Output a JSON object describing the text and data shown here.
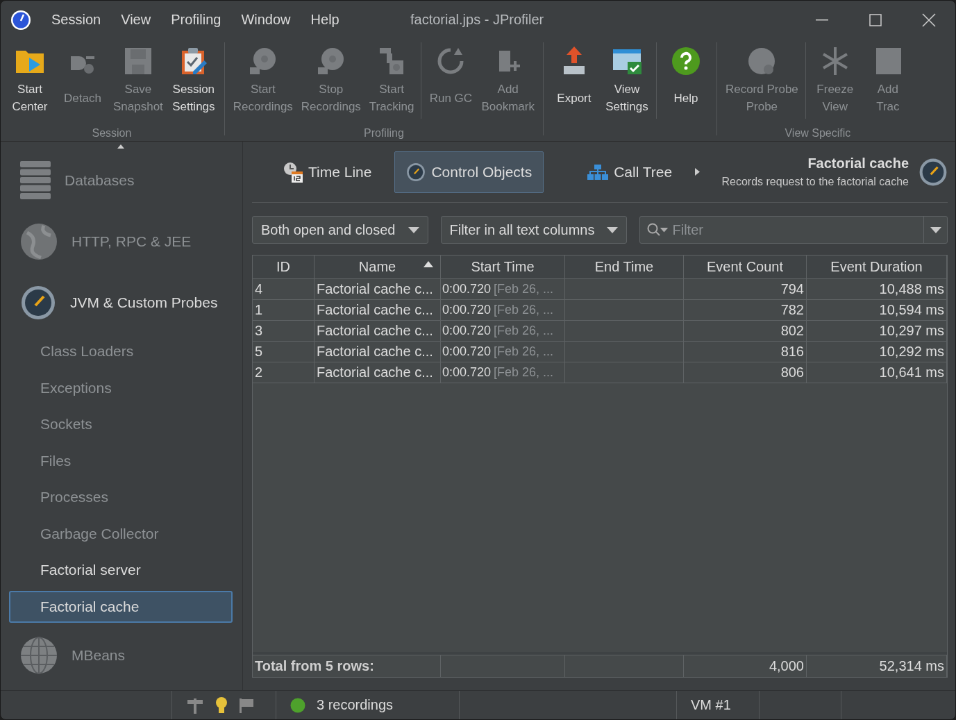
{
  "window": {
    "title": "factorial.jps - JProfiler"
  },
  "menu": [
    {
      "label": "Session"
    },
    {
      "label": "View"
    },
    {
      "label": "Profiling"
    },
    {
      "label": "Window"
    },
    {
      "label": "Help"
    }
  ],
  "toolbar": {
    "groups": [
      {
        "label": "Session",
        "sections": [
          [
            {
              "kind": "start",
              "lines": [
                "Start",
                "Center"
              ],
              "disabled": false
            },
            {
              "kind": "detach",
              "lines": [
                "Detach"
              ],
              "disabled": true
            },
            {
              "kind": "save",
              "lines": [
                "Save",
                "Snapshot"
              ],
              "disabled": true
            },
            {
              "kind": "settings",
              "lines": [
                "Session",
                "Settings"
              ],
              "disabled": false
            }
          ]
        ]
      },
      {
        "label": "Profiling",
        "sections": [
          [
            {
              "kind": "reel",
              "lines": [
                "Start",
                "Recordings"
              ],
              "disabled": true
            },
            {
              "kind": "reel",
              "lines": [
                "Stop",
                "Recordings"
              ],
              "disabled": true
            },
            {
              "kind": "tracking",
              "lines": [
                "Start",
                "Tracking"
              ],
              "disabled": true
            }
          ],
          [
            {
              "kind": "gc",
              "lines": [
                "Run GC"
              ],
              "disabled": true
            },
            {
              "kind": "bookmark",
              "lines": [
                "Add",
                "Bookmark"
              ],
              "disabled": true
            }
          ]
        ]
      },
      {
        "sections": [
          [
            {
              "kind": "export",
              "lines": [
                "Export"
              ],
              "disabled": false
            },
            {
              "kind": "view",
              "lines": [
                "View",
                "Settings"
              ],
              "disabled": false
            }
          ],
          [
            {
              "kind": "help",
              "lines": [
                "Help"
              ],
              "disabled": false
            }
          ]
        ]
      },
      {
        "label": "View Specific",
        "sections": [
          [
            {
              "kind": "probe",
              "lines": [
                "Record Probe",
                "Probe"
              ],
              "disabled": true
            }
          ],
          [
            {
              "kind": "freeze",
              "lines": [
                "Freeze",
                "View"
              ],
              "disabled": true
            },
            {
              "kind": "trace",
              "lines": [
                "Add",
                "Trac"
              ],
              "disabled": true
            }
          ]
        ]
      }
    ]
  },
  "sidebar": {
    "items": [
      {
        "kind": "database",
        "label": "Databases",
        "active": false
      },
      {
        "kind": "globe",
        "label": "HTTP, RPC & JEE",
        "active": false
      },
      {
        "kind": "gauge",
        "label": "JVM & Custom Probes",
        "active": true,
        "children": [
          {
            "label": "Class Loaders",
            "active": false,
            "selected": false
          },
          {
            "label": "Exceptions",
            "active": false,
            "selected": false
          },
          {
            "label": "Sockets",
            "active": false,
            "selected": false
          },
          {
            "label": "Files",
            "active": false,
            "selected": false
          },
          {
            "label": "Processes",
            "active": false,
            "selected": false
          },
          {
            "label": "Garbage Collector",
            "active": false,
            "selected": false
          },
          {
            "label": "Factorial server",
            "active": true,
            "selected": false
          },
          {
            "label": "Factorial cache",
            "active": true,
            "selected": true
          }
        ]
      },
      {
        "kind": "mbean",
        "label": "MBeans",
        "active": false
      }
    ]
  },
  "view_tabs": [
    {
      "kind": "timeline",
      "label": "Time Line",
      "selected": false
    },
    {
      "kind": "control",
      "label": "Control Objects",
      "selected": true
    },
    {
      "kind": "calltree",
      "label": "Call Tree",
      "selected": false
    }
  ],
  "probe_header": {
    "title": "Factorial cache",
    "description": "Records request to the factorial cache"
  },
  "filters": {
    "state_dropdown": "Both open and closed",
    "column_dropdown": "Filter in all text columns",
    "search": {
      "placeholder": "Filter"
    }
  },
  "table": {
    "columns": [
      {
        "label": "ID",
        "sorted": false
      },
      {
        "label": "Name",
        "sorted": true
      },
      {
        "label": "Start Time",
        "sorted": false
      },
      {
        "label": "End Time",
        "sorted": false
      },
      {
        "label": "Event Count",
        "sorted": false
      },
      {
        "label": "Event Duration",
        "sorted": false
      }
    ],
    "rows": [
      {
        "id": "4",
        "name": "Factorial cache c...",
        "start": "0:00.720",
        "start_date": "[Feb 26, ...",
        "count": "794",
        "duration": "10,488 ms"
      },
      {
        "id": "1",
        "name": "Factorial cache c...",
        "start": "0:00.720",
        "start_date": "[Feb 26, ...",
        "count": "782",
        "duration": "10,594 ms"
      },
      {
        "id": "3",
        "name": "Factorial cache c...",
        "start": "0:00.720",
        "start_date": "[Feb 26, ...",
        "count": "802",
        "duration": "10,297 ms"
      },
      {
        "id": "5",
        "name": "Factorial cache c...",
        "start": "0:00.720",
        "start_date": "[Feb 26, ...",
        "count": "816",
        "duration": "10,292 ms"
      },
      {
        "id": "2",
        "name": "Factorial cache c...",
        "start": "0:00.720",
        "start_date": "[Feb 26, ...",
        "count": "806",
        "duration": "10,641 ms"
      }
    ],
    "total": {
      "label": "Total from 5 rows:",
      "count": "4,000",
      "duration": "52,314 ms"
    }
  },
  "status_bar": {
    "recordings": "3 recordings",
    "vm": "VM #1"
  }
}
